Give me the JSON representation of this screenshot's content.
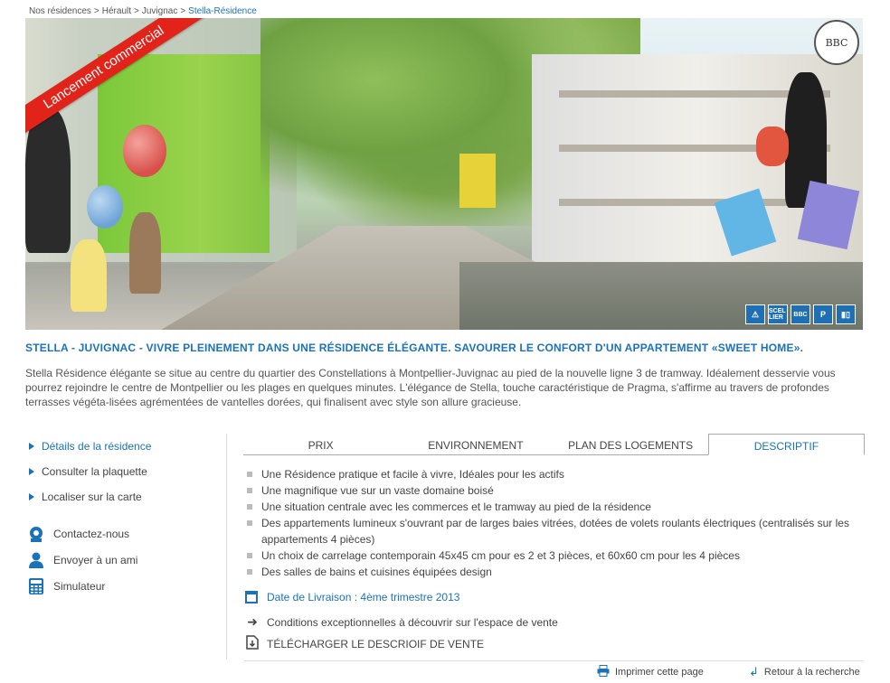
{
  "breadcrumb": {
    "items": [
      "Nos résidences",
      "Hérault",
      "Juvignac"
    ],
    "current": "Stella-Résidence",
    "separator": ">"
  },
  "hero": {
    "ribbon_text": "Lancement commercial",
    "seal_text": "BBC",
    "badges": [
      {
        "icon": "warning-icon",
        "label": "⚠"
      },
      {
        "icon": "scellier-badge",
        "label": "SCEL LIER"
      },
      {
        "icon": "bbc-badge",
        "label": "BBC"
      },
      {
        "icon": "parking-icon",
        "label": "P"
      },
      {
        "icon": "elevator-icon",
        "label": "▮▯"
      }
    ]
  },
  "headline": "STELLA - JUVIGNAC - VIVRE PLEINEMENT DANS UNE RÉSIDENCE ÉLÉGANTE. SAVOURER LE CONFORT D'UN APPARTEMENT «SWEET HOME».",
  "intro": "Stella Résidence élégante se situe au centre du quartier des Constellations à Montpellier-Juvignac au pied de la nouvelle ligne 3 de tramway. Idéalement desservie vous pourrez rejoindre le centre de Montpellier ou les plages en quelques minutes. L'élégance de Stella, touche caractéristique de Pragma, s'affirme au travers de profondes terrasses végéta-lisées agrémentées de vantelles dorées, qui finalisent avec style son allure gracieuse.",
  "sidenav": {
    "links": [
      {
        "label": "Détails de la résidence",
        "active": true
      },
      {
        "label": "Consulter la plaquette",
        "active": false
      },
      {
        "label": "Localiser sur la carte",
        "active": false
      }
    ],
    "contacts": [
      {
        "label": "Contactez-nous",
        "icon": "contact-icon"
      },
      {
        "label": "Envoyer à un ami",
        "icon": "user-icon"
      },
      {
        "label": "Simulateur",
        "icon": "calculator-icon"
      }
    ]
  },
  "tabs": [
    {
      "label": "PRIX",
      "active": false
    },
    {
      "label": "ENVIRONNEMENT",
      "active": false
    },
    {
      "label": "PLAN DES LOGEMENTS",
      "active": false
    },
    {
      "label": "DESCRIPTIF",
      "active": true
    }
  ],
  "features": [
    "Une Résidence pratique et facile à vivre, Idéales pour les actifs",
    "Une magnifique vue sur un vaste domaine boisé",
    "Une situation centrale avec les commerces et le tramway au pied de la résidence",
    "Des appartements lumineux s'ouvrant par de larges baies vitrées, dotées de volets roulants électriques (centralisés sur les appartements 4 pièces)",
    "Un choix de carrelage contemporain 45x45 cm pour es 2 et 3 pièces, et 60x60 cm pour les 4 pièces",
    "Des salles de bains et cuisines équipées design"
  ],
  "delivery": "Date de Livraison : 4ème trimestre 2013",
  "actions": {
    "conditions": "Conditions exceptionnelles à découvrir sur l'espace de vente",
    "download": "TÉLÉCHARGER LE DESCRIOIF DE VENTE"
  },
  "footer": {
    "print": "Imprimer cette page",
    "back": "Retour à la recherche"
  },
  "colors": {
    "accent": "#1a73b8",
    "ribbon": "#e2231a",
    "text": "#444444"
  }
}
